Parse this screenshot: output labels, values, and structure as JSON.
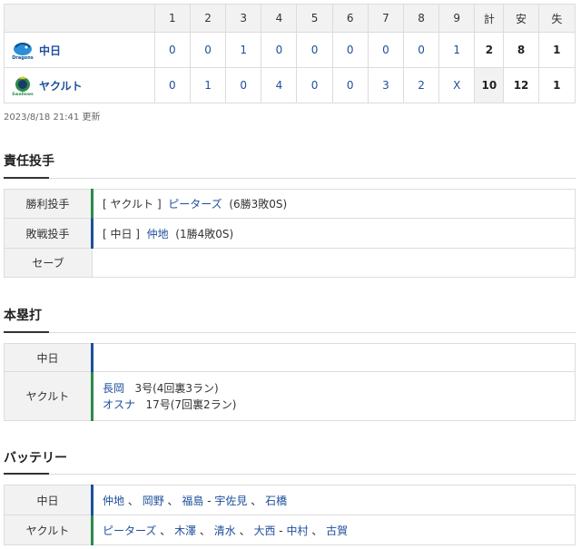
{
  "scoreboard": {
    "headers": [
      "1",
      "2",
      "3",
      "4",
      "5",
      "6",
      "7",
      "8",
      "9",
      "計",
      "安",
      "失"
    ],
    "teams": [
      {
        "name": "中日",
        "innings": [
          "0",
          "0",
          "1",
          "0",
          "0",
          "0",
          "0",
          "0",
          "1"
        ],
        "runs": "2",
        "hits": "8",
        "errors": "1"
      },
      {
        "name": "ヤクルト",
        "innings": [
          "0",
          "1",
          "0",
          "4",
          "0",
          "0",
          "3",
          "2",
          "X"
        ],
        "runs": "10",
        "hits": "12",
        "errors": "1"
      }
    ],
    "updated": "2023/8/18 21:41 更新"
  },
  "pitchers": {
    "title": "責任投手",
    "rows": [
      {
        "label": "勝利投手",
        "team": "[ ヤクルト ]",
        "name": "ピーターズ",
        "record": "(6勝3敗0S)"
      },
      {
        "label": "敗戦投手",
        "team": "[ 中日 ]",
        "name": "仲地",
        "record": "(1勝4敗0S)"
      },
      {
        "label": "セーブ",
        "team": "",
        "name": "",
        "record": ""
      }
    ]
  },
  "homeruns": {
    "title": "本塁打",
    "rows": [
      {
        "label": "中日",
        "entries": []
      },
      {
        "label": "ヤクルト",
        "entries": [
          {
            "name": "長岡",
            "detail": "3号(4回裏3ラン)"
          },
          {
            "name": "オスナ",
            "detail": "17号(7回裏2ラン)"
          }
        ]
      }
    ]
  },
  "battery": {
    "title": "バッテリー",
    "rows": [
      {
        "label": "中日",
        "pitchers": [
          "仲地",
          "岡野",
          "福島"
        ],
        "catchers": [
          "宇佐見",
          "石橋"
        ]
      },
      {
        "label": "ヤクルト",
        "pitchers": [
          "ピーターズ",
          "木澤",
          "清水",
          "大西"
        ],
        "catchers": [
          "中村",
          "古賀"
        ]
      }
    ],
    "sep": "、",
    "dash": "-"
  },
  "colors": {
    "link": "#1e4f9c",
    "swallows_bar": "#2b8a4b",
    "dragons_bar": "#1e4f9c"
  }
}
